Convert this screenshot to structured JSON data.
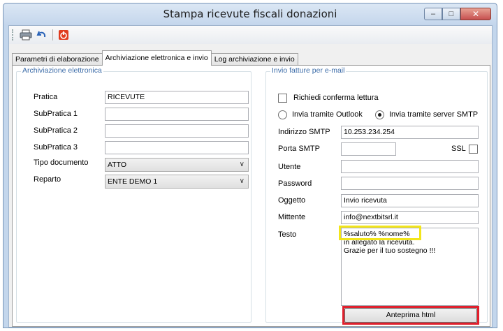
{
  "window": {
    "title": "Stampa ricevute fiscali donazioni",
    "minimize_glyph": "–",
    "maximize_glyph": "□",
    "close_glyph": "✕"
  },
  "toolbar": {
    "icons": [
      "printer-icon",
      "undo-icon",
      "power-icon"
    ],
    "power_icon_color": "#e03b1f"
  },
  "tabs": [
    {
      "label": "Parametri di elaborazione",
      "active": false
    },
    {
      "label": "Archiviazione elettronica e invio",
      "active": true
    },
    {
      "label": "Log archiviazione e invio",
      "active": false
    }
  ],
  "archiviazione": {
    "legend": "Archiviazione elettronica",
    "pratica_label": "Pratica",
    "pratica_value": "RICEVUTE",
    "subpratica1_label": "SubPratica 1",
    "subpratica1_value": "",
    "subpratica2_label": "SubPratica 2",
    "subpratica2_value": "",
    "subpratica3_label": "SubPratica 3",
    "subpratica3_value": "",
    "tipo_documento_label": "Tipo documento",
    "tipo_documento_value": "ATTO",
    "reparto_label": "Reparto",
    "reparto_value": "ENTE DEMO 1",
    "dropdown_glyph": "∨"
  },
  "invio": {
    "legend": "Invio fatture per e-mail",
    "richiedi_conferma_label": "Richiedi conferma lettura",
    "richiedi_conferma_checked": false,
    "outlook_label": "Invia tramite Outlook",
    "smtp_server_label": "Invia tramite server SMTP",
    "selected_mode": "smtp",
    "indirizzo_smtp_label": "Indirizzo SMTP",
    "indirizzo_smtp_value": "10.253.234.254",
    "porta_smtp_label": "Porta SMTP",
    "porta_smtp_value": "",
    "ssl_label": "SSL",
    "ssl_checked": false,
    "utente_label": "Utente",
    "utente_value": "",
    "password_label": "Password",
    "password_value": "",
    "oggetto_label": "Oggetto",
    "oggetto_value": "Invio ricevuta",
    "mittente_label": "Mittente",
    "mittente_value": "info@nextbitsrl.it",
    "testo_label": "Testo",
    "testo_value": "%saluto% %nome%\nin allegato la ricevuta.\nGrazie per il tuo sostegno !!!",
    "anteprima_button": "Anteprima html"
  },
  "highlight_colors": {
    "yellow": "#f2e51b",
    "red": "#e0202d"
  }
}
